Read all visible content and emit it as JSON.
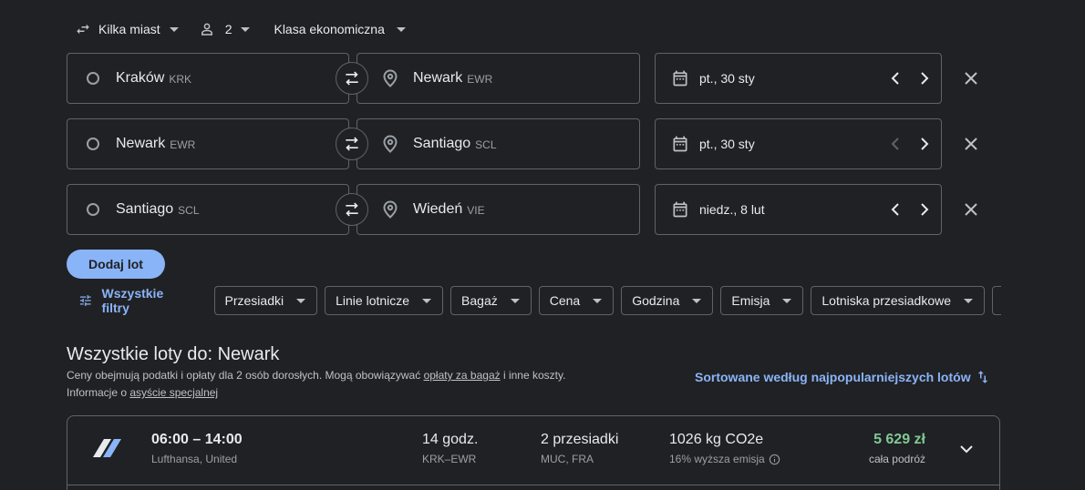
{
  "top_bar": {
    "trip_type": "Kilka miast",
    "passengers": "2",
    "cabin_class": "Klasa ekonomiczna"
  },
  "legs": [
    {
      "from_city": "Kraków",
      "from_code": "KRK",
      "to_city": "Newark",
      "to_code": "EWR",
      "date": "pt., 30 sty",
      "prev_enabled": true
    },
    {
      "from_city": "Newark",
      "from_code": "EWR",
      "to_city": "Santiago",
      "to_code": "SCL",
      "date": "pt., 30 sty",
      "prev_enabled": false
    },
    {
      "from_city": "Santiago",
      "from_code": "SCL",
      "to_city": "Wiedeń",
      "to_code": "VIE",
      "date": "niedz., 8 lut",
      "prev_enabled": true
    }
  ],
  "add_flight_label": "Dodaj lot",
  "filters": {
    "all_label": "Wszystkie filtry",
    "chips": [
      "Przesiadki",
      "Linie lotnicze",
      "Bagaż",
      "Cena",
      "Godzina",
      "Emisja",
      "Lotniska przesiadkowe"
    ]
  },
  "results": {
    "title": "Wszystkie loty do: Newark",
    "note_line1_a": "Ceny obejmują podatki i opłaty dla 2 osób dorosłych. Mogą obowiązywać ",
    "note_link1": "opłaty za bagaż",
    "note_line1_b": " i inne koszty.",
    "note_line2_a": "Informacje o ",
    "note_link2": "asyście specjalnej",
    "sort_label": "Sortowane według najpopularniejszych lotów"
  },
  "flight": {
    "times": "06:00 – 14:00",
    "airlines": "Lufthansa, United",
    "duration": "14 godz.",
    "route": "KRK–EWR",
    "stops": "2 przesiadki",
    "stop_airports": "MUC, FRA",
    "emissions": "1026 kg CO2e",
    "emissions_note": "16% wyższa emisja",
    "price": "5 629 zł",
    "price_note": "cała podróż"
  },
  "colors": {
    "background": "#202124",
    "accent": "#8ab4f8",
    "price_green": "#81c995",
    "border": "#5f6368"
  }
}
